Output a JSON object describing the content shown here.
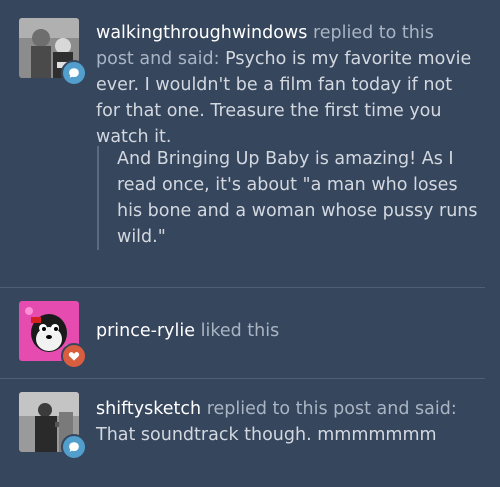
{
  "notes": [
    {
      "username": "walkingthroughwindows",
      "action": "replied to this post and said:",
      "reply": "Psycho is my favorite movie ever. I wouldn't be a film fan today if not for that one. Treasure the first time you watch it.",
      "quote": "And Bringing Up Baby is amazing! As I read once, it's about \"a man who loses his bone and a woman whose pussy runs wild.\"",
      "badge_icon": "reply-icon",
      "badge_color": "#529ecc"
    },
    {
      "username": "prince-rylie",
      "action": "liked this",
      "badge_icon": "heart-icon",
      "badge_color": "#d95e40"
    },
    {
      "username": "shiftysketch",
      "action": "replied to this post and said:",
      "reply": "That soundtrack though. mmmmmmm",
      "badge_icon": "reply-icon",
      "badge_color": "#529ecc"
    }
  ],
  "colors": {
    "background": "#36465d",
    "divider": "#4f5f76",
    "text": "#d3d8e0",
    "username": "#ffffff"
  }
}
